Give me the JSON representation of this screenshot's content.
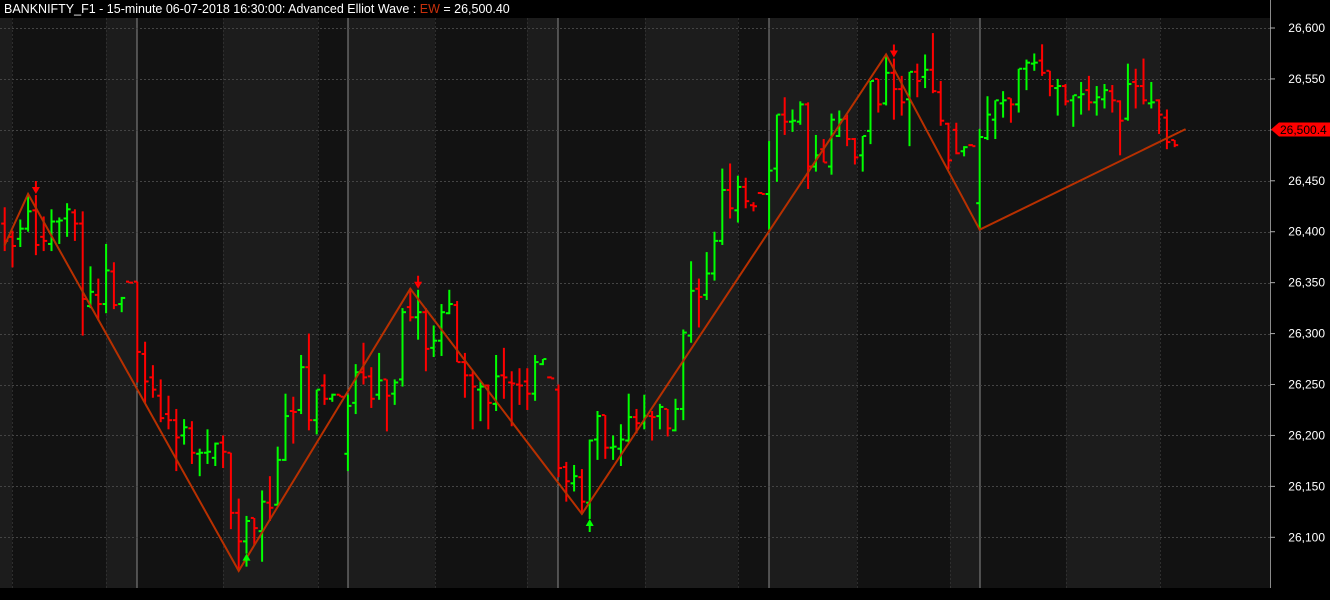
{
  "title": {
    "prefix": "BANKNIFTY_F1 - 15-minute 06-07-2018 16:30:00: Advanced Elliot Wave : ",
    "indicator": "EW",
    "suffix": " = 26,500.40"
  },
  "colors": {
    "up": "#00ff00",
    "down": "#ff0000",
    "wave": "#b83000",
    "tag": "#ff0000",
    "band_light": "#1c1c1c",
    "band_dark": "#121212"
  },
  "chart_data": {
    "type": "ohlc",
    "title": "BANKNIFTY_F1 - 15-minute - Advanced Elliot Wave",
    "ylim": [
      26050,
      26650
    ],
    "y_ticks": [
      26100,
      26150,
      26200,
      26250,
      26300,
      26350,
      26400,
      26450,
      26500,
      26550,
      26600
    ],
    "y_tick_labels": [
      "26,100",
      "26,150",
      "26,200",
      "26,250",
      "26,300",
      "26,350",
      "26,400",
      "26,450",
      "26,500",
      "26,550",
      "26,600"
    ],
    "grid": true,
    "last_value": 26500.4,
    "last_value_label": "26,500.4",
    "bar_fields": [
      "open",
      "high",
      "low",
      "close"
    ],
    "bars": [
      [
        26408,
        26424,
        26381,
        26391
      ],
      [
        26395,
        26401,
        26365,
        26386
      ],
      [
        26393,
        26412,
        26385,
        26403
      ],
      [
        26403,
        26437,
        26400,
        26420
      ],
      [
        26421,
        26436,
        26377,
        26387
      ],
      [
        26395,
        26415,
        26381,
        26391
      ],
      [
        26388,
        26422,
        26381,
        26410
      ],
      [
        26410,
        26414,
        26388,
        26411
      ],
      [
        26413,
        26428,
        26395,
        26422
      ],
      [
        26419,
        26422,
        26391,
        26408
      ],
      [
        26408,
        26420,
        26298,
        26334
      ],
      [
        26327,
        26366,
        26325,
        26341
      ],
      [
        26338,
        26354,
        26313,
        26329
      ],
      [
        26329,
        26388,
        26320,
        26362
      ],
      [
        26361,
        26370,
        26324,
        26328
      ],
      [
        26329,
        26336,
        26321,
        26335
      ],
      [
        26351,
        26351,
        26350,
        26350
      ],
      [
        26351,
        26351,
        26252,
        26282
      ],
      [
        26280,
        26292,
        26232,
        26253
      ],
      [
        26257,
        26269,
        26237,
        26245
      ],
      [
        26239,
        26255,
        26213,
        26217
      ],
      [
        26221,
        26239,
        26206,
        26215
      ],
      [
        26215,
        26226,
        26165,
        26198
      ],
      [
        26200,
        26216,
        26191,
        26208
      ],
      [
        26207,
        26214,
        26172,
        26183
      ],
      [
        26182,
        26187,
        26160,
        26183
      ],
      [
        26183,
        26206,
        26172,
        26184
      ],
      [
        26178,
        26193,
        26170,
        26192
      ],
      [
        26193,
        26200,
        26168,
        26184
      ],
      [
        26183,
        26183,
        26108,
        26124
      ],
      [
        26124,
        26138,
        26067,
        26096
      ],
      [
        26096,
        26121,
        26084,
        26116
      ],
      [
        26119,
        26119,
        26092,
        26109
      ],
      [
        26106,
        26146,
        26076,
        26135
      ],
      [
        26134,
        26160,
        26116,
        26129
      ],
      [
        26132,
        26189,
        26131,
        26176
      ],
      [
        26176,
        26241,
        26175,
        26219
      ],
      [
        26224,
        26238,
        26192,
        26223
      ],
      [
        26225,
        26279,
        26221,
        26267
      ],
      [
        26267,
        26300,
        26205,
        26215
      ],
      [
        26215,
        26245,
        26201,
        26245
      ],
      [
        26249,
        26260,
        26230,
        26236
      ],
      [
        26236,
        26241,
        26233,
        26240
      ],
      [
        26240,
        26240,
        26238,
        26238
      ],
      [
        26182,
        26240,
        26165,
        26229
      ],
      [
        26232,
        26270,
        26221,
        26262
      ],
      [
        26262,
        26291,
        26250,
        26257
      ],
      [
        26258,
        26267,
        26227,
        26236
      ],
      [
        26240,
        26281,
        26235,
        26254
      ],
      [
        26255,
        26255,
        26204,
        26239
      ],
      [
        26241,
        26255,
        26230,
        26252
      ],
      [
        26255,
        26325,
        26248,
        26321
      ],
      [
        26326,
        26344,
        26312,
        26316
      ],
      [
        26316,
        26343,
        26294,
        26321
      ],
      [
        26321,
        26325,
        26263,
        26285
      ],
      [
        26286,
        26308,
        26277,
        26293
      ],
      [
        26293,
        26329,
        26278,
        26321
      ],
      [
        26320,
        26343,
        26319,
        26329
      ],
      [
        26328,
        26332,
        26272,
        26272
      ],
      [
        26272,
        26281,
        26237,
        26259
      ],
      [
        26259,
        26263,
        26206,
        26248
      ],
      [
        26245,
        26254,
        26214,
        26248
      ],
      [
        26249,
        26250,
        26206,
        26232
      ],
      [
        26231,
        26279,
        26224,
        26258
      ],
      [
        26259,
        26286,
        26236,
        26257
      ],
      [
        26252,
        26263,
        26209,
        26251
      ],
      [
        26250,
        26266,
        26230,
        26249
      ],
      [
        26253,
        26266,
        26225,
        26241
      ],
      [
        26241,
        26279,
        26234,
        26272
      ],
      [
        26270,
        26275,
        26269,
        26275
      ],
      [
        26257,
        26258,
        26256,
        26256
      ],
      [
        26245,
        26250,
        26159,
        26168
      ],
      [
        26169,
        26174,
        26135,
        26155
      ],
      [
        26153,
        26171,
        26145,
        26160
      ],
      [
        26159,
        26167,
        26123,
        26135
      ],
      [
        26134,
        26196,
        26118,
        26195
      ],
      [
        26196,
        26224,
        26176,
        26219
      ],
      [
        26220,
        26220,
        26177,
        26188
      ],
      [
        26188,
        26200,
        26176,
        26189
      ],
      [
        26187,
        26211,
        26170,
        26196
      ],
      [
        26195,
        26241,
        26193,
        26218
      ],
      [
        26218,
        26226,
        26202,
        26212
      ],
      [
        26212,
        26240,
        26206,
        26219
      ],
      [
        26219,
        26224,
        26195,
        26218
      ],
      [
        26219,
        26231,
        26206,
        26228
      ],
      [
        26226,
        26226,
        26199,
        26207
      ],
      [
        26205,
        26236,
        26204,
        26226
      ],
      [
        26226,
        26304,
        26215,
        26301
      ],
      [
        26298,
        26371,
        26291,
        26342
      ],
      [
        26344,
        26354,
        26306,
        26336
      ],
      [
        26338,
        26380,
        26333,
        26359
      ],
      [
        26359,
        26400,
        26352,
        26391
      ],
      [
        26391,
        26462,
        26387,
        26441
      ],
      [
        26441,
        26467,
        26413,
        26423
      ],
      [
        26421,
        26455,
        26409,
        26444
      ],
      [
        26444,
        26453,
        26423,
        26430
      ],
      [
        26426,
        26429,
        26420,
        26425
      ],
      [
        26438,
        26439,
        26437,
        26437
      ],
      [
        26437,
        26489,
        26402,
        26460
      ],
      [
        26462,
        26515,
        26449,
        26515
      ],
      [
        26515,
        26532,
        26495,
        26508
      ],
      [
        26508,
        26520,
        26498,
        26509
      ],
      [
        26508,
        26528,
        26505,
        26525
      ],
      [
        26525,
        26527,
        26442,
        26464
      ],
      [
        26464,
        26495,
        26459,
        26475
      ],
      [
        26481,
        26491,
        26468,
        26468
      ],
      [
        26464,
        26516,
        26456,
        26510
      ],
      [
        26494,
        26519,
        26493,
        26510
      ],
      [
        26511,
        26515,
        26484,
        26491
      ],
      [
        26491,
        26492,
        26466,
        26473
      ],
      [
        26475,
        26494,
        26459,
        26494
      ],
      [
        26499,
        26548,
        26486,
        26548
      ],
      [
        26550,
        26550,
        26517,
        26525
      ],
      [
        26526,
        26574,
        26524,
        26556
      ],
      [
        26556,
        26570,
        26510,
        26540
      ],
      [
        26540,
        26553,
        26514,
        26527
      ],
      [
        26530,
        26557,
        26484,
        26557
      ],
      [
        26557,
        26565,
        26532,
        26548
      ],
      [
        26552,
        26574,
        26541,
        26559
      ],
      [
        26559,
        26595,
        26536,
        26538
      ],
      [
        26537,
        26548,
        26504,
        26509
      ],
      [
        26506,
        26507,
        26461,
        26470
      ],
      [
        26500,
        26507,
        26476,
        26477
      ],
      [
        26479,
        26484,
        26474,
        26483
      ],
      [
        26485,
        26486,
        26484,
        26484
      ],
      [
        26428,
        26501,
        26402,
        26493
      ],
      [
        26492,
        26533,
        26490,
        26515
      ],
      [
        26510,
        26529,
        26491,
        26529
      ],
      [
        26526,
        26538,
        26512,
        26529
      ],
      [
        26531,
        26531,
        26507,
        26525
      ],
      [
        26525,
        26560,
        26517,
        26560
      ],
      [
        26560,
        26569,
        26539,
        26566
      ],
      [
        26565,
        26575,
        26558,
        26566
      ],
      [
        26568,
        26584,
        26553,
        26556
      ],
      [
        26558,
        26558,
        26533,
        26543
      ],
      [
        26541,
        26550,
        26514,
        26543
      ],
      [
        26543,
        26545,
        26524,
        26528
      ],
      [
        26529,
        26534,
        26503,
        26534
      ],
      [
        26532,
        26547,
        26515,
        26535
      ],
      [
        26539,
        26553,
        26519,
        26527
      ],
      [
        26527,
        26543,
        26514,
        26532
      ],
      [
        26530,
        26545,
        26521,
        26539
      ],
      [
        26538,
        26544,
        26517,
        26529
      ],
      [
        26528,
        26529,
        26475,
        26509
      ],
      [
        26511,
        26565,
        26509,
        26545
      ],
      [
        26547,
        26560,
        26521,
        26543
      ],
      [
        26543,
        26570,
        26525,
        26529
      ],
      [
        26526,
        26547,
        26521,
        26527
      ],
      [
        26529,
        26530,
        26496,
        26515
      ],
      [
        26512,
        26520,
        26481,
        26488
      ],
      [
        26490,
        26490,
        26483,
        26485
      ]
    ],
    "elliott_wave": [
      {
        "bar": 0,
        "price": 26387
      },
      {
        "bar": 3,
        "price": 26437
      },
      {
        "bar": 30,
        "price": 26067
      },
      {
        "bar": 52,
        "price": 26344
      },
      {
        "bar": 74,
        "price": 26123
      },
      {
        "bar": 113,
        "price": 26574
      },
      {
        "bar": 125,
        "price": 26402
      },
      {
        "bar": 151.3,
        "price": 26500.4
      }
    ],
    "signals": [
      {
        "bar": 4,
        "type": "sell"
      },
      {
        "bar": 31,
        "type": "buy"
      },
      {
        "bar": 53,
        "type": "sell"
      },
      {
        "bar": 75,
        "type": "buy"
      },
      {
        "bar": 114,
        "type": "sell"
      }
    ]
  }
}
